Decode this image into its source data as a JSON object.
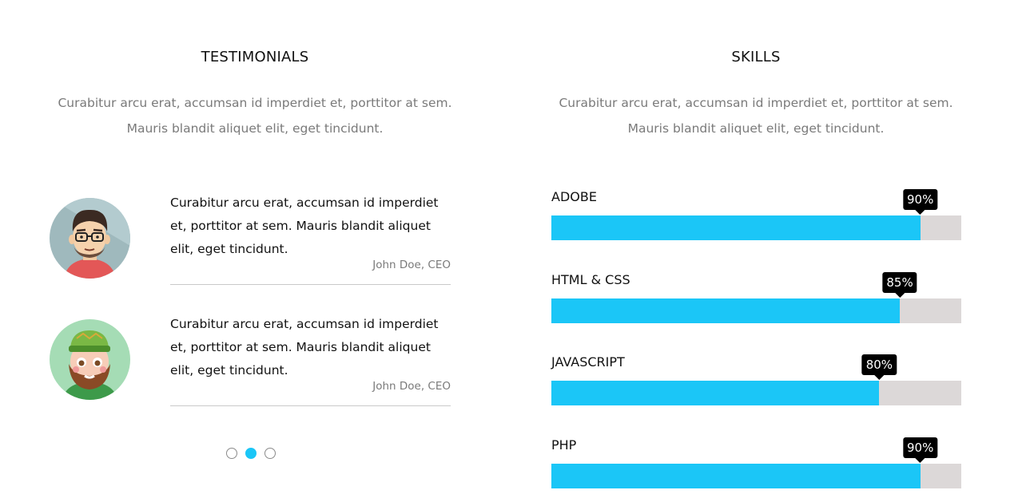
{
  "testimonials": {
    "title": "TESTIMONIALS",
    "description_line1": "Curabitur arcu erat, accumsan id imperdiet et, porttitor at sem.",
    "description_line2": "Mauris blandit aliquet elit, eget tincidunt.",
    "items": [
      {
        "avatar_icon": "man-with-glasses-avatar-icon",
        "quote": "Curabitur arcu erat, accumsan id imperdiet et, porttitor at sem. Mauris blandit aliquet elit, eget tincidunt.",
        "author": "John Doe, CEO"
      },
      {
        "avatar_icon": "bearded-man-green-hat-avatar-icon",
        "quote": "Curabitur arcu erat, accumsan id imperdiet et, porttitor at sem. Mauris blandit aliquet elit, eget tincidunt.",
        "author": "John Doe, CEO"
      }
    ],
    "pagination": {
      "count": 3,
      "active_index": 1
    }
  },
  "skills": {
    "title": "SKILLS",
    "description_line1": "Curabitur arcu erat, accumsan id imperdiet et, porttitor at sem.",
    "description_line2": "Mauris blandit aliquet elit, eget tincidunt.",
    "items": [
      {
        "label": "ADOBE",
        "percent": 90,
        "percent_label": "90%"
      },
      {
        "label": "HTML & CSS",
        "percent": 85,
        "percent_label": "85%"
      },
      {
        "label": "JAVASCRIPT",
        "percent": 80,
        "percent_label": "80%"
      },
      {
        "label": "PHP",
        "percent": 90,
        "percent_label": "90%"
      }
    ]
  },
  "colors": {
    "accent": "#1bc6f7",
    "track": "#dcd8d8",
    "tooltip": "#000000",
    "muted_text": "#7a7a7a",
    "divider": "#c9c9c9"
  }
}
